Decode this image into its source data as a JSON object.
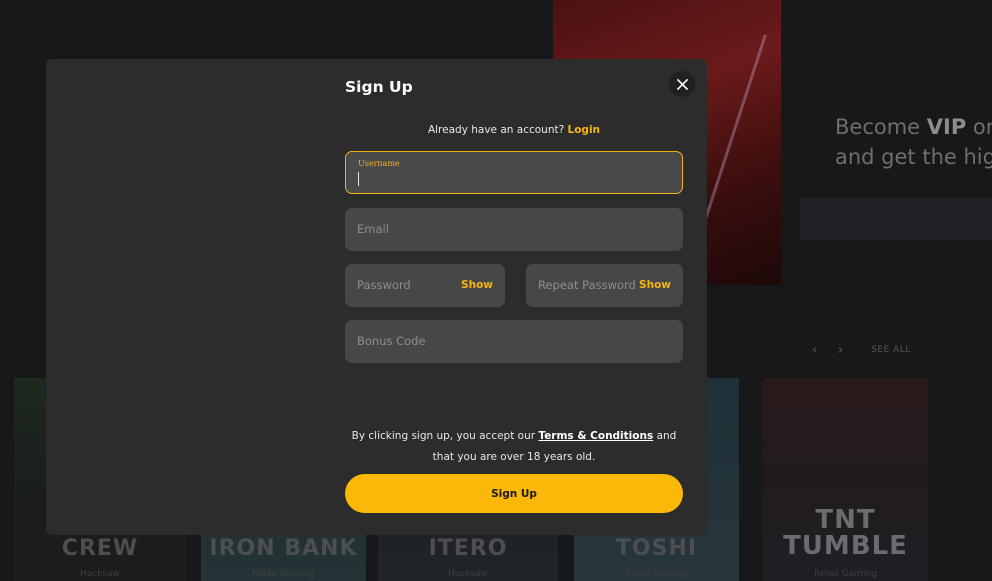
{
  "background": {
    "promo_line1_prefix": "Become ",
    "promo_line1_bold": "VIP",
    "promo_line1_suffix": " on",
    "promo_line2": "and get the hig",
    "see_all": "SEE ALL",
    "arrow_prev": "‹",
    "arrow_next": "›",
    "tiles": [
      {
        "name": "CHAOS CREW",
        "sub": "Hacksaw"
      },
      {
        "name": "IRON BANK",
        "sub": "Relax Gaming"
      },
      {
        "name": "ITERO",
        "sub": "Hacksaw"
      },
      {
        "name": "TOSHI",
        "sub": "Relax Gaming"
      },
      {
        "name": "TNT TUMBLE",
        "sub": "Relax Gaming"
      }
    ]
  },
  "modal": {
    "title": "Sign Up",
    "close_icon": "close-icon",
    "login_prompt": "Already have an account?",
    "login_link": "Login",
    "fields": {
      "username": {
        "label": "Username",
        "value": ""
      },
      "email": {
        "placeholder": "Email",
        "value": ""
      },
      "password": {
        "placeholder": "Password",
        "value": "",
        "toggle": "Show"
      },
      "repeat_password": {
        "placeholder": "Repeat Password",
        "value": "",
        "toggle": "Show"
      },
      "bonus_code": {
        "placeholder": "Bonus Code",
        "value": ""
      }
    },
    "terms_prefix": "By clicking sign up, you accept our",
    "terms_link": "Terms & Conditions",
    "terms_suffix": "and that you are over 18 years old.",
    "submit_label": "Sign Up"
  },
  "colors": {
    "accent": "#fbb809",
    "modal_bg": "#2c2c2c",
    "field_bg": "#474747",
    "page_bg": "#16181a"
  }
}
